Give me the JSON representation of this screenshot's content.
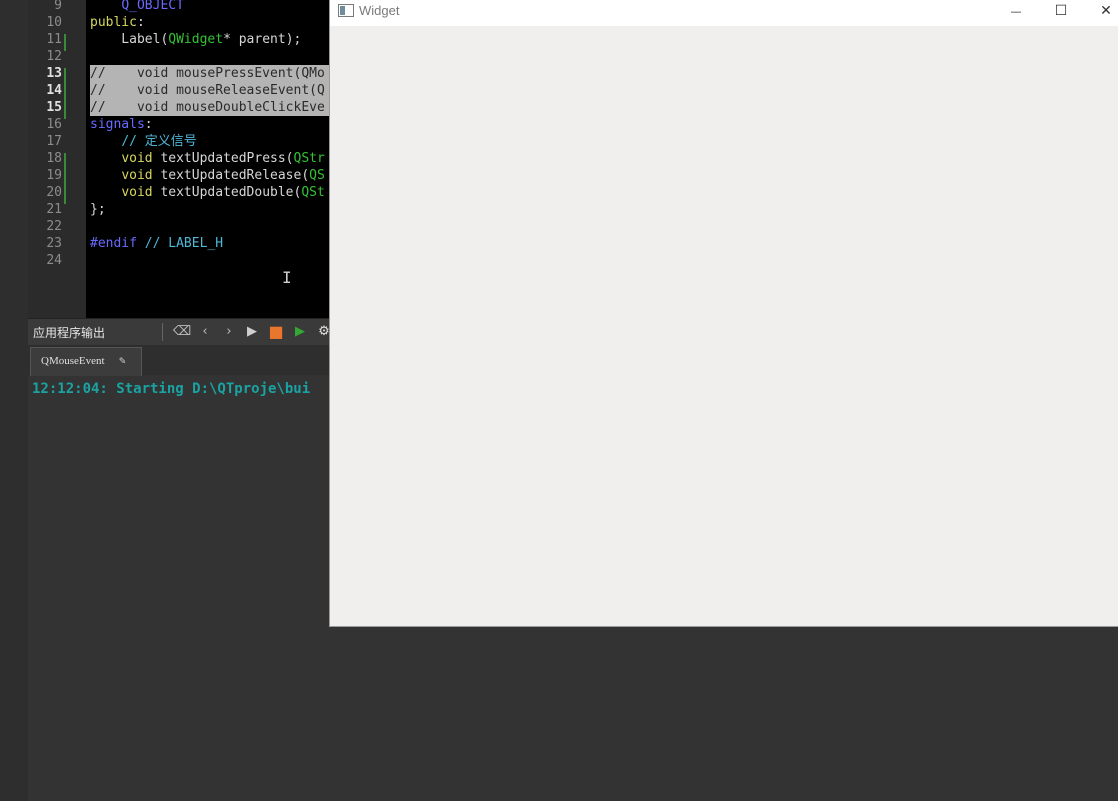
{
  "editor": {
    "lines": [
      {
        "num": "9",
        "current": false,
        "tokens": [
          {
            "t": "    ",
            "c": ""
          },
          {
            "t": "Q_OBJECT",
            "c": "macro"
          }
        ]
      },
      {
        "num": "10",
        "current": false,
        "tokens": [
          {
            "t": "public",
            "c": "kw"
          },
          {
            "t": ":",
            "c": ""
          }
        ]
      },
      {
        "num": "11",
        "current": false,
        "tokens": [
          {
            "t": "    Label(",
            "c": ""
          },
          {
            "t": "QWidget",
            "c": "type"
          },
          {
            "t": "* parent);",
            "c": ""
          }
        ]
      },
      {
        "num": "12",
        "current": false,
        "tokens": []
      },
      {
        "num": "13",
        "current": true,
        "selected": true,
        "tokens": [
          {
            "t": "//    void mousePressEvent(QMo",
            "c": ""
          }
        ]
      },
      {
        "num": "14",
        "current": true,
        "selected": true,
        "tokens": [
          {
            "t": "//    void mouseReleaseEvent(Q",
            "c": ""
          }
        ]
      },
      {
        "num": "15",
        "current": true,
        "selected": true,
        "tokens": [
          {
            "t": "//    void mouseDoubleClickEve",
            "c": ""
          }
        ]
      },
      {
        "num": "16",
        "current": false,
        "tokens": [
          {
            "t": "signals",
            "c": "macro"
          },
          {
            "t": ":",
            "c": ""
          }
        ]
      },
      {
        "num": "17",
        "current": false,
        "tokens": [
          {
            "t": "    ",
            "c": ""
          },
          {
            "t": "// 定义信号",
            "c": "comment"
          }
        ]
      },
      {
        "num": "18",
        "current": false,
        "tokens": [
          {
            "t": "    ",
            "c": ""
          },
          {
            "t": "void",
            "c": "kw"
          },
          {
            "t": " textUpdatedPress(",
            "c": ""
          },
          {
            "t": "QStr",
            "c": "type"
          }
        ]
      },
      {
        "num": "19",
        "current": false,
        "tokens": [
          {
            "t": "    ",
            "c": ""
          },
          {
            "t": "void",
            "c": "kw"
          },
          {
            "t": " textUpdatedRelease(",
            "c": ""
          },
          {
            "t": "QS",
            "c": "type"
          }
        ]
      },
      {
        "num": "20",
        "current": false,
        "tokens": [
          {
            "t": "    ",
            "c": ""
          },
          {
            "t": "void",
            "c": "kw"
          },
          {
            "t": " textUpdatedDouble(",
            "c": ""
          },
          {
            "t": "QSt",
            "c": "type"
          }
        ]
      },
      {
        "num": "21",
        "current": false,
        "tokens": [
          {
            "t": "};",
            "c": ""
          }
        ]
      },
      {
        "num": "22",
        "current": false,
        "tokens": []
      },
      {
        "num": "23",
        "current": false,
        "tokens": [
          {
            "t": "#endif",
            "c": "macro"
          },
          {
            "t": " // LABEL_H",
            "c": "comment"
          }
        ]
      },
      {
        "num": "24",
        "current": false,
        "tokens": []
      }
    ]
  },
  "output_pane": {
    "title": "应用程序输出",
    "toolbar": [
      {
        "name": "clear-icon",
        "glyph": "⌫"
      },
      {
        "name": "prev-icon",
        "glyph": "‹"
      },
      {
        "name": "next-icon",
        "glyph": "›"
      },
      {
        "name": "run-icon",
        "glyph": "▶"
      },
      {
        "name": "stop-icon",
        "glyph": "■"
      },
      {
        "name": "debug-icon",
        "glyph": "▶"
      },
      {
        "name": "settings-icon",
        "glyph": "⚙"
      }
    ],
    "tab_label": "QMouseEvent",
    "tab_pin_glyph": "✎",
    "log_text": "12:12:04: Starting D:\\QTproje\\bui"
  },
  "widget_window": {
    "title": "Widget",
    "minimize_glyph": "—",
    "maximize_glyph": "☐",
    "close_glyph": "✕"
  },
  "colors": {
    "ide_background": "#333333",
    "editor_background": "#000000",
    "keyword": "#d7d75f",
    "macro": "#6a6aff",
    "type": "#34c134",
    "comment": "#4fb6d6",
    "selection": "#b4b4b4",
    "log_text": "#1aa3a3",
    "widget_background": "#f0efed",
    "stop_button": "#e8762c",
    "debug_button": "#34a834"
  }
}
